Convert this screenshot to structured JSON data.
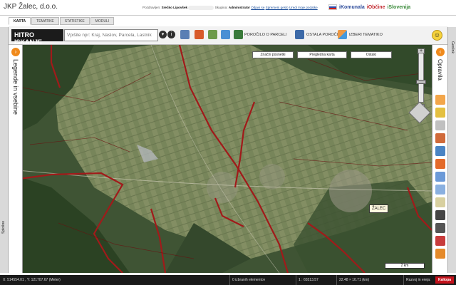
{
  "header": {
    "app_title": "JKP Žalec, d.o.o.",
    "greeting_label": "Pozdravljen:",
    "user_name": "Srečko Lipovšek",
    "group_label": "Skupina:",
    "group_value": "Administrator",
    "logout_link": "Odjavi se",
    "change_password_link": "Spremeni geslo",
    "edit_profile_link": "Uredi moje podatke",
    "brands": [
      "iKomunala",
      "iObčine",
      "iSlovenija"
    ]
  },
  "tabs": [
    "KARTA",
    "TEMATIKE",
    "STATISTIKE",
    "MODULI"
  ],
  "left_side_tab": "Splošno",
  "right_side_tab": "Geolink",
  "toolbar": {
    "quick_search_label": "HITRO ISKANJE",
    "search_placeholder": "Vpišite npr: Kraj, Naslov, Parcela, Lastnik",
    "parcel_report_label": "POROČILO O PARCELI",
    "other_reports_label": "OSTALA POROČILA",
    "select_theme_label": "IZBERI TEMATIKO"
  },
  "legend_panel_label": "Legende in vsebine",
  "right_panel_label": "Opravila",
  "map": {
    "buttons": [
      "Značni posnetki",
      "Pregledna karta",
      "Ostalo"
    ],
    "place_label": "ŽALEC",
    "scale_label": "2 km"
  },
  "status_bar": {
    "coordinates": "X: 514554.01 , Y: 121707.67 (Meter)",
    "selected": "0 izbranih elementov",
    "scale": "1 : 65513.57",
    "extent": "22.48 × 10.71 (km)",
    "company": "Razvoj in ereja:",
    "badge": "Kaliopa"
  },
  "colors": {
    "boundary": "#a11a1a",
    "accent_orange": "#f08a1c",
    "badge_red": "#c4121c"
  }
}
